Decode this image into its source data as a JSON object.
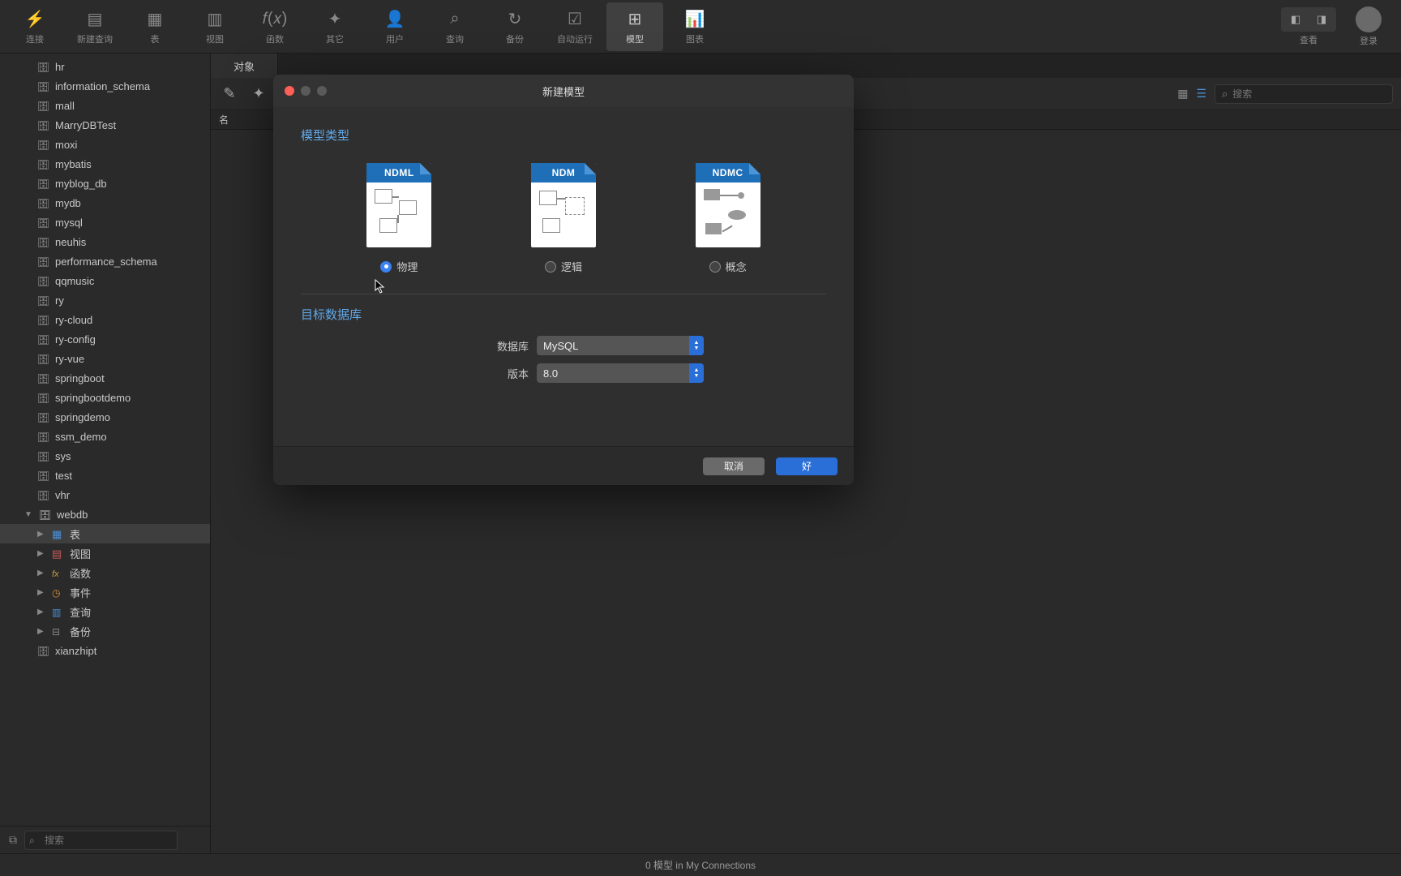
{
  "toolbar": {
    "items": [
      {
        "id": "connect",
        "label": "连接"
      },
      {
        "id": "newquery",
        "label": "新建查询"
      },
      {
        "id": "table",
        "label": "表"
      },
      {
        "id": "view",
        "label": "视图"
      },
      {
        "id": "function",
        "label": "函数"
      },
      {
        "id": "other",
        "label": "其它"
      },
      {
        "id": "user",
        "label": "用户"
      },
      {
        "id": "query",
        "label": "查询"
      },
      {
        "id": "backup",
        "label": "备份"
      },
      {
        "id": "autorun",
        "label": "自动运行"
      },
      {
        "id": "model",
        "label": "模型",
        "active": true
      },
      {
        "id": "chart",
        "label": "图表"
      }
    ],
    "view_label": "查看",
    "login_label": "登录"
  },
  "sidebar": {
    "databases": [
      "hr",
      "information_schema",
      "mall",
      "MarryDBTest",
      "moxi",
      "mybatis",
      "myblog_db",
      "mydb",
      "mysql",
      "neuhis",
      "performance_schema",
      "qqmusic",
      "ry",
      "ry-cloud",
      "ry-config",
      "ry-vue",
      "springboot",
      "springbootdemo",
      "springdemo",
      "ssm_demo",
      "sys",
      "test",
      "vhr"
    ],
    "expanded_db": "webdb",
    "children": [
      {
        "id": "table",
        "label": "表",
        "icon": "table",
        "selected": true
      },
      {
        "id": "view",
        "label": "视图",
        "icon": "view"
      },
      {
        "id": "fx",
        "label": "函数",
        "icon": "fx"
      },
      {
        "id": "event",
        "label": "事件",
        "icon": "event"
      },
      {
        "id": "query",
        "label": "查询",
        "icon": "query"
      },
      {
        "id": "backup",
        "label": "备份",
        "icon": "backup"
      }
    ],
    "databases_after": [
      "xianzhipt"
    ],
    "search_placeholder": "搜索"
  },
  "content": {
    "tab_label": "对象",
    "column_header": "名",
    "search_placeholder": "搜索"
  },
  "modal": {
    "title": "新建模型",
    "section_model_type": "模型类型",
    "types": [
      {
        "id": "physical",
        "file_ext": "NDML",
        "label": "物理",
        "checked": true
      },
      {
        "id": "logical",
        "file_ext": "NDM",
        "label": "逻辑",
        "checked": false
      },
      {
        "id": "concept",
        "file_ext": "NDMC",
        "label": "概念",
        "checked": false
      }
    ],
    "section_target_db": "目标数据库",
    "db_label": "数据库",
    "db_value": "MySQL",
    "ver_label": "版本",
    "ver_value": "8.0",
    "cancel": "取消",
    "ok": "好"
  },
  "statusbar": "0 模型 in My Connections"
}
